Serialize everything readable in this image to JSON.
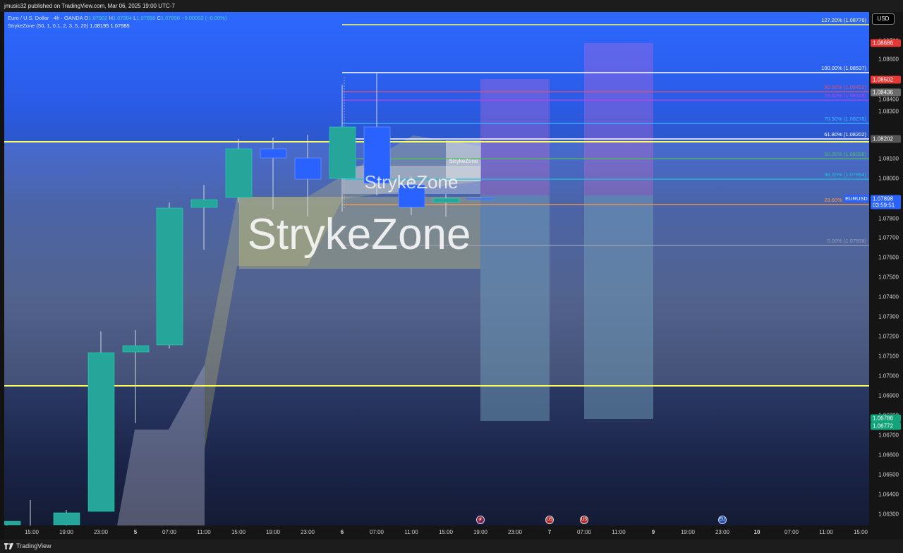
{
  "header": {
    "text": "jmusic32 published on TradingView.com, Mar 06, 2025 19:00 UTC-7"
  },
  "footer": {
    "brand": "TradingView"
  },
  "legend": {
    "symbol": "Euro / U.S. Dollar · 4h · OANDA",
    "o_label": "O",
    "o_value": "1.07902",
    "h_label": "H",
    "h_value": "1.07904",
    "l_label": "L",
    "l_value": "1.07896",
    "c_label": "C",
    "c_value": "1.07898",
    "change": "−0.00002 (−0.00%)",
    "indicator": "StrykeZone (50, 1, 0.1, 2, 3, 5, 20)",
    "ind_v1": "1.08195",
    "ind_v2": "1.07985"
  },
  "watermarks": {
    "big": "StrykeZone",
    "mid": "StrykeZone",
    "small": "StrykeZone"
  },
  "currency_button": "USD",
  "fib_levels": [
    {
      "label": "127.20% (1.08776)",
      "color": "#ffff66"
    },
    {
      "label": "100.00% (1.08537)",
      "color": "#ffffff"
    },
    {
      "label": "90.00% (1.08452)",
      "color": "#e0506e"
    },
    {
      "label": "78.60% (1.08349)",
      "color": "#c040e0"
    },
    {
      "label": "70.50% (1.08278)",
      "color": "#40b8ff"
    },
    {
      "label": "61.80% (1.08202)",
      "color": "#ffffff"
    },
    {
      "label": "50.00% (1.08096)",
      "color": "#4cbf5a"
    },
    {
      "label": "38.20% (1.07994)",
      "color": "#18c4d8"
    },
    {
      "label": "23.60% (1.07868)",
      "color": "#ff9a40"
    },
    {
      "label": "0.00% (1.07658)",
      "color": "#9aa0b8"
    }
  ],
  "price_axis": {
    "ticks": [
      "1.08700",
      "1.08600",
      "1.08400",
      "1.08300",
      "1.08100",
      "1.08000",
      "1.07900",
      "1.07800",
      "1.07700",
      "1.07600",
      "1.07500",
      "1.07400",
      "1.07300",
      "1.07200",
      "1.07100",
      "1.07000",
      "1.06900",
      "1.06800",
      "1.06700",
      "1.06600",
      "1.06500",
      "1.06400",
      "1.06300"
    ],
    "labels": [
      {
        "text": "1.08686",
        "color": "#e53935"
      },
      {
        "text": "1.08502",
        "color": "#e53935"
      },
      {
        "text": "1.08436",
        "color": "#6b6b6b"
      },
      {
        "text": "1.08202",
        "color": "#555555"
      },
      {
        "text": "1.07898",
        "color": "#2962ff"
      },
      {
        "text": "03:59:51",
        "color": "#2962ff"
      },
      {
        "text": "1.06786",
        "color": "#12a37a"
      },
      {
        "text": "1.06772",
        "color": "#12a37a"
      }
    ],
    "symbol_tag": "EURUSD"
  },
  "time_axis": {
    "ticks": [
      "15:00",
      "19:00",
      "23:00",
      "5",
      "07:00",
      "11:00",
      "15:00",
      "19:00",
      "23:00",
      "6",
      "07:00",
      "11:00",
      "15:00",
      "19:00",
      "23:00",
      "7",
      "07:00",
      "11:00",
      "9",
      "19:00",
      "23:00",
      "10",
      "07:00",
      "11:00",
      "15:00"
    ]
  },
  "colors": {
    "bull": "#26a69a",
    "bear": "#2962ff",
    "hline": "#ffff55"
  },
  "events": [
    {
      "name": "lightning-event-icon",
      "glyph": "⚡"
    },
    {
      "name": "us-flag-event-icon",
      "glyph": "US"
    },
    {
      "name": "us-flag-event-icon",
      "glyph": "US"
    },
    {
      "name": "eu-flag-event-icon",
      "glyph": "EU"
    }
  ]
}
